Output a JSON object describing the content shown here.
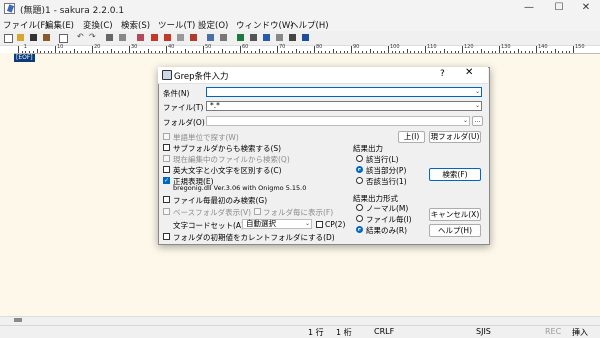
{
  "window": {
    "title": "(無題)1 - sakura 2.2.0.1",
    "min": "—",
    "max": "☐",
    "close": "✕"
  },
  "menu": [
    "ファイル(F)",
    "編集(E)",
    "変換(C)",
    "検索(S)",
    "ツール(T)",
    "設定(O)",
    "ウィンドウ(W)",
    "ヘルプ(H)"
  ],
  "ruler": {
    "labels": [
      "1",
      "10",
      "20",
      "30",
      "40",
      "50",
      "60",
      "70",
      "80",
      "90",
      "100",
      "110",
      "120",
      "130",
      "140",
      "150"
    ]
  },
  "editor": {
    "eof": "[EOF]"
  },
  "dialog": {
    "title": "Grep条件入力",
    "help": "?",
    "close": "✕",
    "condition_label": "条件(N)",
    "condition_value": "",
    "file_label": "ファイル(T)",
    "file_value": "*.*",
    "folder_label": "フォルダ(O)",
    "folder_value": "",
    "folder_browse": "...",
    "up_button": "上(I)",
    "current_folder_button": "現フォルダ(U)",
    "options": {
      "word": "単語単位で探す(W)",
      "subfolder": "サブフォルダからも検索する(S)",
      "current_file": "現在編集中のファイルから検索(Q)",
      "case": "英大文字と小文字を区別する(C)",
      "regex": "正規表現(E)",
      "regex_info": "bregonig.dll Ver.3.06 with Onigmo 5.15.0",
      "first_only": "ファイル毎最初のみ検索(G)",
      "base_folder": "ベースフォルダ表示(V)",
      "per_folder": "フォルダ毎に表示(F)",
      "charset_label": "文字コードセット(A)",
      "charset_value": "自動選択",
      "cp": "CP(2)",
      "set_current": "フォルダの初期値をカレントフォルダにする(D)"
    },
    "result_output": {
      "heading": "結果出力",
      "opts": [
        "該当行(L)",
        "該当部分(P)",
        "否該当行(1)"
      ],
      "selected": 1
    },
    "output_format": {
      "heading": "結果出力形式",
      "opts": [
        "ノーマル(M)",
        "ファイル毎(I)",
        "結果のみ(R)"
      ],
      "selected": 2
    },
    "search_button": "検索(F)",
    "cancel_button": "キャンセル(X)",
    "help_button": "ヘルプ(H)"
  },
  "status": {
    "line": "1 行",
    "col": "1 桁",
    "eol": "CRLF",
    "encoding": "SJIS",
    "rec": "REC",
    "mode": "挿入"
  },
  "colors": {
    "editor_bg": "#fdf8ea",
    "accent": "#0067c0",
    "eof_bg": "#0a3b7a"
  }
}
